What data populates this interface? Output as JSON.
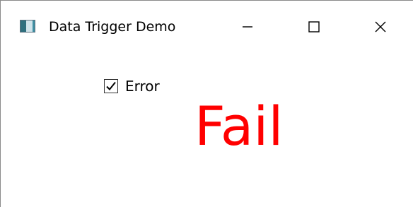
{
  "window": {
    "title": "Data Trigger Demo",
    "icon": "app-window-icon",
    "controls": [
      "minimize-icon",
      "maximize-icon",
      "close-icon"
    ]
  },
  "form": {
    "checkbox": {
      "label": "Error",
      "checked": true
    },
    "result_text": "Fail",
    "result_color": "#ff0000"
  }
}
